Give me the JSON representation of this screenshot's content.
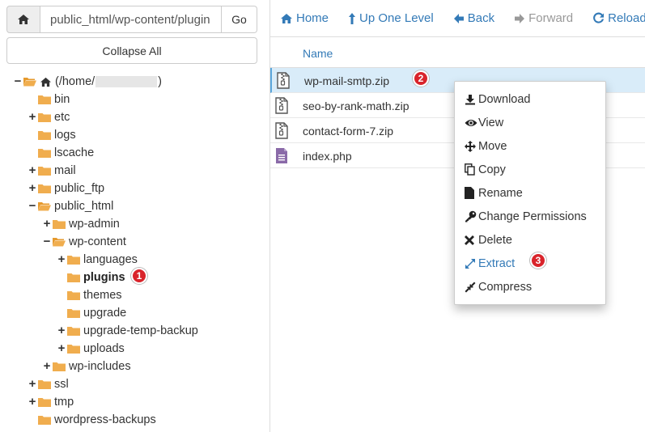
{
  "path_bar": {
    "home_icon": "home-icon",
    "path_value": "public_html/wp-content/plugin",
    "go_label": "Go"
  },
  "collapse_all_label": "Collapse All",
  "tree": {
    "root_label_prefix": "(/home/",
    "root_label_suffix": ")",
    "items": [
      {
        "label": "bin",
        "toggle": ""
      },
      {
        "label": "etc",
        "toggle": "+"
      },
      {
        "label": "logs",
        "toggle": ""
      },
      {
        "label": "lscache",
        "toggle": ""
      },
      {
        "label": "mail",
        "toggle": "+"
      },
      {
        "label": "public_ftp",
        "toggle": "+"
      },
      {
        "label": "public_html",
        "toggle": "−"
      },
      {
        "label": "wp-admin",
        "toggle": "+"
      },
      {
        "label": "wp-content",
        "toggle": "−"
      },
      {
        "label": "languages",
        "toggle": "+"
      },
      {
        "label": "plugins",
        "toggle": ""
      },
      {
        "label": "themes",
        "toggle": ""
      },
      {
        "label": "upgrade",
        "toggle": ""
      },
      {
        "label": "upgrade-temp-backup",
        "toggle": "+"
      },
      {
        "label": "uploads",
        "toggle": "+"
      },
      {
        "label": "wp-includes",
        "toggle": "+"
      },
      {
        "label": "ssl",
        "toggle": "+"
      },
      {
        "label": "tmp",
        "toggle": "+"
      },
      {
        "label": "wordpress-backups",
        "toggle": ""
      }
    ]
  },
  "toolbar": {
    "home": "Home",
    "up_one_level": "Up One Level",
    "back": "Back",
    "forward": "Forward",
    "reload": "Reload"
  },
  "file_list": {
    "column_name": "Name",
    "files": [
      {
        "name": "wp-mail-smtp.zip",
        "icon": "zip-file-icon"
      },
      {
        "name": "seo-by-rank-math.zip",
        "icon": "zip-file-icon"
      },
      {
        "name": "contact-form-7.zip",
        "icon": "zip-file-icon"
      },
      {
        "name": "index.php",
        "icon": "text-file-icon"
      }
    ]
  },
  "context_menu": {
    "items": [
      {
        "label": "Download",
        "icon": "download-icon"
      },
      {
        "label": "View",
        "icon": "eye-icon"
      },
      {
        "label": "Move",
        "icon": "move-icon"
      },
      {
        "label": "Copy",
        "icon": "copy-icon"
      },
      {
        "label": "Rename",
        "icon": "file-icon"
      },
      {
        "label": "Change Permissions",
        "icon": "key-icon"
      },
      {
        "label": "Delete",
        "icon": "x-icon"
      },
      {
        "label": "Extract",
        "icon": "expand-icon"
      },
      {
        "label": "Compress",
        "icon": "compress-icon"
      }
    ]
  },
  "badges": {
    "one": "1",
    "two": "2",
    "three": "3"
  },
  "colors": {
    "link": "#337ab7",
    "folder": "#f0ad4e",
    "badge": "#d9242b",
    "selected_row": "#d9ecf9"
  }
}
